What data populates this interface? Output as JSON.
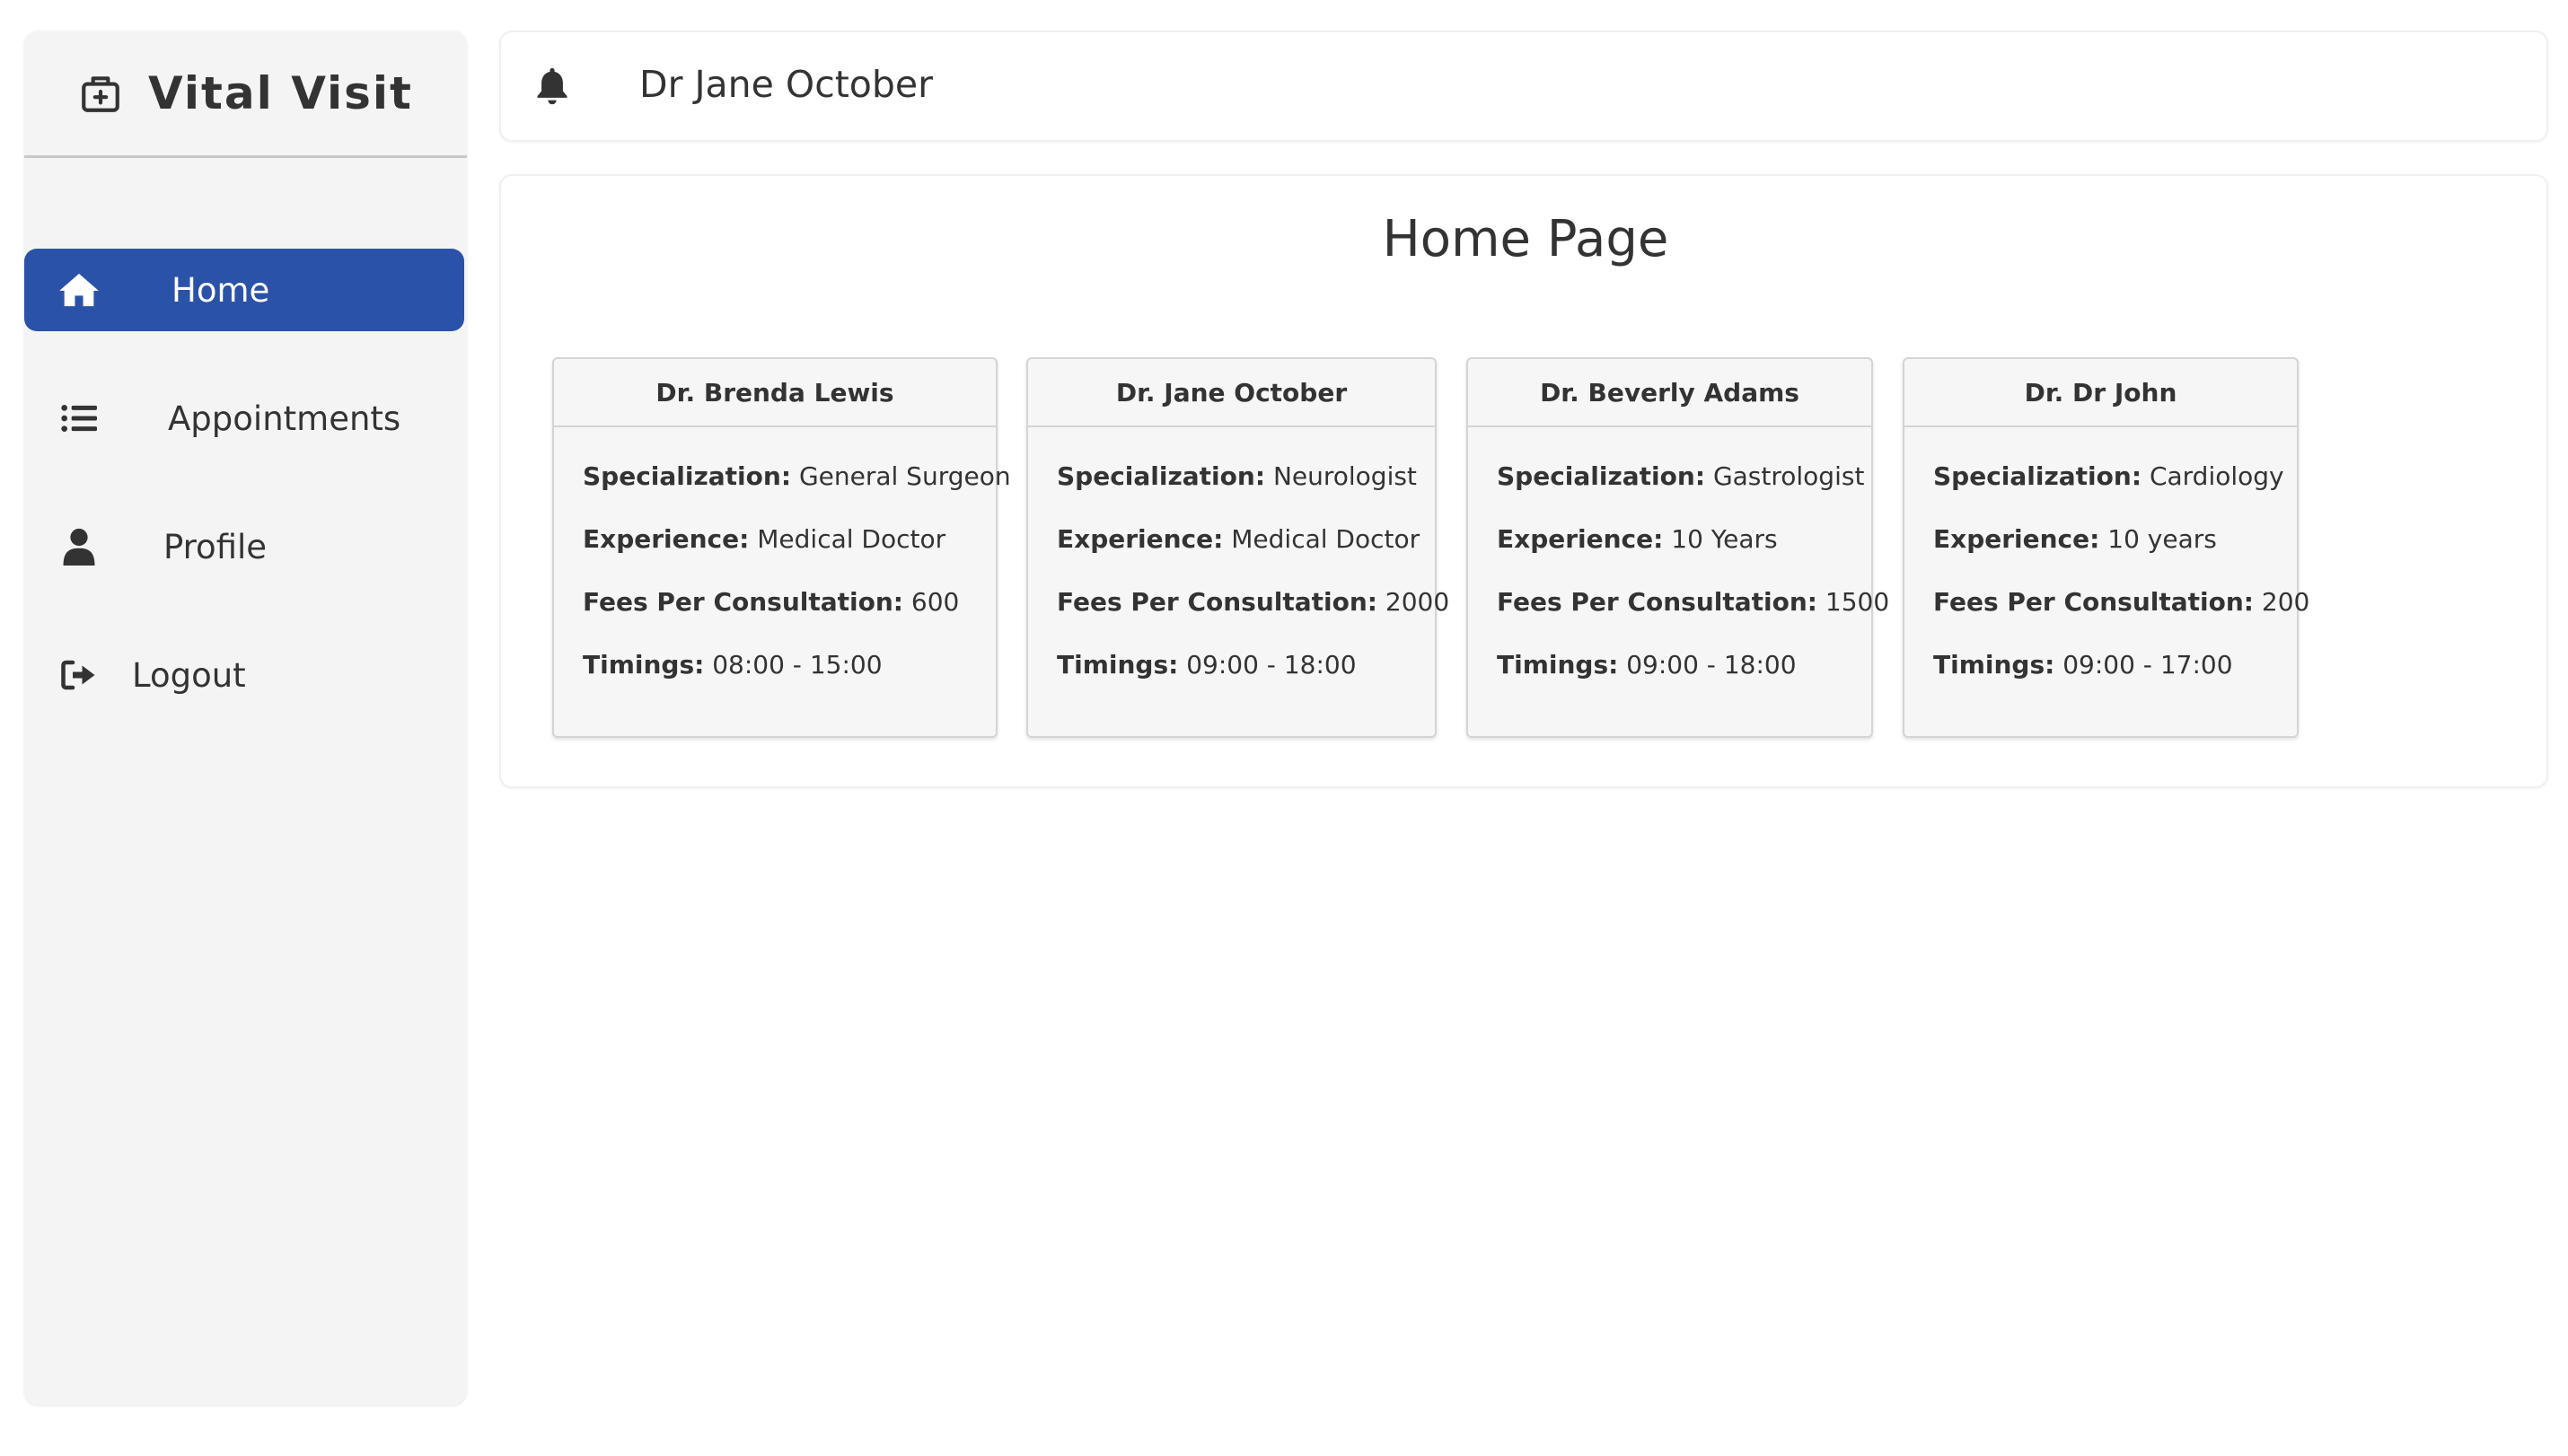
{
  "app": {
    "brand": "Vital Visit",
    "brand_icon": "medical-kit-icon"
  },
  "sidebar": {
    "items": [
      {
        "label": "Home",
        "icon": "home-icon",
        "active": true
      },
      {
        "label": "Appointments",
        "icon": "list-icon",
        "active": false
      },
      {
        "label": "Profile",
        "icon": "user-icon",
        "active": false
      },
      {
        "label": "Logout",
        "icon": "logout-icon",
        "active": false
      }
    ]
  },
  "header": {
    "notification_icon": "bell-icon",
    "user_name": "Dr Jane October"
  },
  "main": {
    "title": "Home Page",
    "field_labels": {
      "specialization": "Specialization:",
      "experience": "Experience:",
      "fees": "Fees Per Consultation:",
      "timings": "Timings:"
    },
    "doctors": [
      {
        "name": "Dr. Brenda Lewis",
        "specialization": "General Surgeon",
        "experience": "Medical Doctor",
        "fees": "600",
        "timings": "08:00 - 15:00"
      },
      {
        "name": "Dr. Jane October",
        "specialization": "Neurologist",
        "experience": "Medical Doctor",
        "fees": "2000",
        "timings": "09:00 - 18:00"
      },
      {
        "name": "Dr. Beverly Adams",
        "specialization": "Gastrologist",
        "experience": "10 Years",
        "fees": "1500",
        "timings": "09:00 - 18:00"
      },
      {
        "name": "Dr. Dr John",
        "specialization": "Cardiology",
        "experience": "10 years",
        "fees": "200",
        "timings": "09:00 - 17:00"
      }
    ]
  },
  "colors": {
    "primary": "#2a52a8",
    "sidebar_bg": "#f4f4f4",
    "text": "#333333"
  }
}
